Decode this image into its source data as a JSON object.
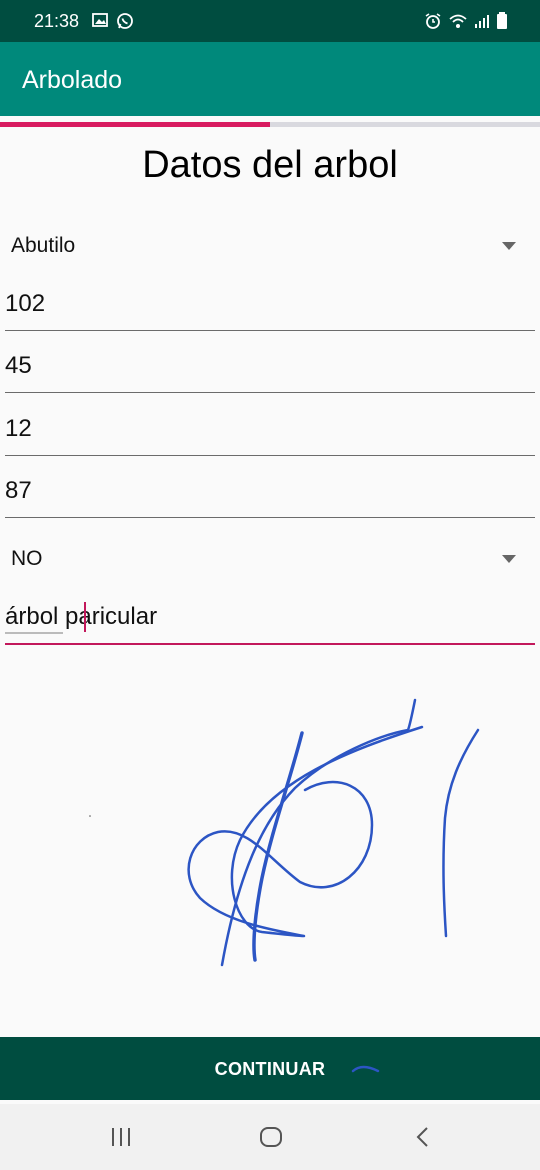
{
  "status_bar": {
    "time": "21:38",
    "icons": [
      "image-icon",
      "whatsapp-icon",
      "alarm-icon",
      "wifi-icon",
      "signal-icon",
      "battery-icon"
    ]
  },
  "app_bar": {
    "title": "Arbolado",
    "color": "#00897b"
  },
  "progress": {
    "value": 0.5,
    "color": "#d81b60"
  },
  "form": {
    "title": "Datos del arbol",
    "species_select": "Abutilo",
    "fields": [
      "102",
      "45",
      "12",
      "87"
    ],
    "yes_no_select": "NO",
    "notes_value": "árbol paricular"
  },
  "footer": {
    "continue_label": "CONTINUAR"
  },
  "nav": {
    "icons": [
      "recent-apps-icon",
      "home-icon",
      "back-icon"
    ]
  },
  "colors": {
    "status_bar": "#004d40",
    "accent": "#c2185b",
    "continue_bar": "#004d40",
    "signature_ink": "#2c55c4"
  }
}
